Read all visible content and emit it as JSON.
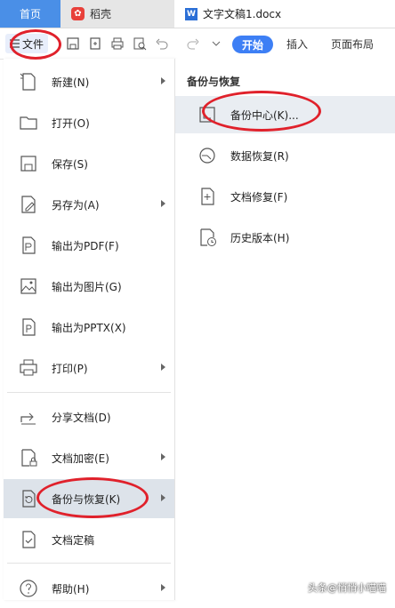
{
  "tabs": {
    "home": "首页",
    "daoke": "稻壳",
    "document": "文字文稿1.docx"
  },
  "toolbar": {
    "file_label": "文件",
    "ribbon": [
      "开始",
      "插入",
      "页面布局"
    ]
  },
  "menu": {
    "items": [
      {
        "label": "新建(N)",
        "icon": "new-file-icon",
        "submenu": true
      },
      {
        "label": "打开(O)",
        "icon": "folder-icon",
        "submenu": false
      },
      {
        "label": "保存(S)",
        "icon": "save-icon",
        "submenu": false
      },
      {
        "label": "另存为(A)",
        "icon": "save-as-icon",
        "submenu": true
      },
      {
        "label": "输出为PDF(F)",
        "icon": "pdf-icon",
        "submenu": false
      },
      {
        "label": "输出为图片(G)",
        "icon": "image-icon",
        "submenu": false
      },
      {
        "label": "输出为PPTX(X)",
        "icon": "pptx-icon",
        "submenu": false
      },
      {
        "label": "打印(P)",
        "icon": "print-icon",
        "submenu": true
      },
      {
        "label": "分享文档(D)",
        "icon": "share-icon",
        "submenu": false
      },
      {
        "label": "文档加密(E)",
        "icon": "encrypt-icon",
        "submenu": true
      },
      {
        "label": "备份与恢复(K)",
        "icon": "backup-icon",
        "submenu": true
      },
      {
        "label": "文档定稿",
        "icon": "finalize-icon",
        "submenu": false
      },
      {
        "label": "帮助(H)",
        "icon": "help-icon",
        "submenu": true
      }
    ]
  },
  "panel": {
    "title": "备份与恢复",
    "items": [
      {
        "label": "备份中心(K)...",
        "icon": "backup-center-icon"
      },
      {
        "label": "数据恢复(R)",
        "icon": "data-recovery-icon"
      },
      {
        "label": "文档修复(F)",
        "icon": "doc-repair-icon"
      },
      {
        "label": "历史版本(H)",
        "icon": "history-icon"
      }
    ]
  },
  "watermark": "头条@悄悄小喵喵",
  "colors": {
    "accent": "#3d7ff5",
    "home_tab": "#4a8fe7",
    "annotation": "#e0212b"
  }
}
